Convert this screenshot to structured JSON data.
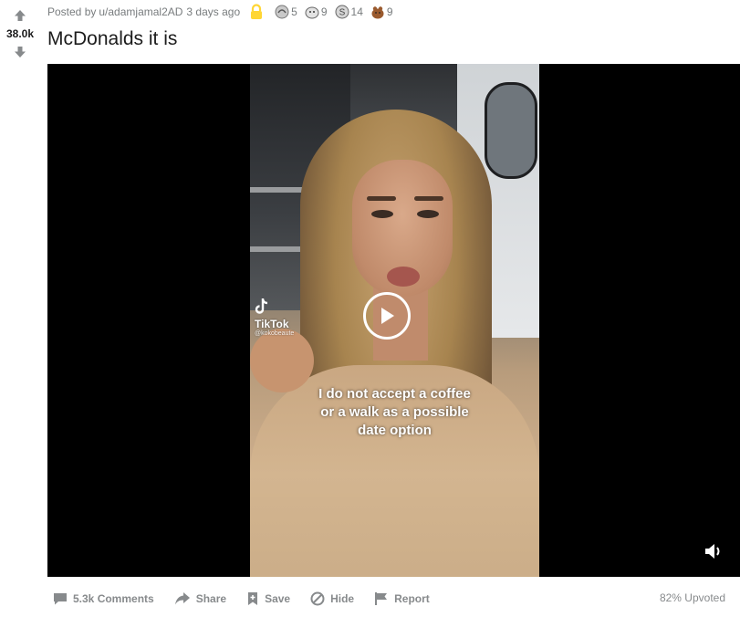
{
  "post": {
    "score": "38.0k",
    "posted_by": "Posted by",
    "author": "u/adamjamal2AD",
    "time": "3 days ago",
    "title": "McDonalds it is",
    "awards": [
      {
        "icon": "award-icon-1",
        "count": "5"
      },
      {
        "icon": "award-icon-2",
        "count": "9"
      },
      {
        "icon": "award-icon-3",
        "count": "14"
      },
      {
        "icon": "award-icon-4",
        "count": "9"
      }
    ]
  },
  "video": {
    "watermark_brand": "TikTok",
    "watermark_handle": "@kokobeaute",
    "caption_lines": [
      "I do not accept a coffee",
      "or a walk as a possible",
      "date option"
    ]
  },
  "actions": {
    "comments": "5.3k Comments",
    "share": "Share",
    "save": "Save",
    "hide": "Hide",
    "report": "Report",
    "upvoted": "82% Upvoted"
  },
  "colors": {
    "meta_text": "#787c7e",
    "action_text": "#878a8c",
    "title_text": "#1c1c1c",
    "player_bg": "#000000",
    "lock_award": "#ffd635"
  }
}
